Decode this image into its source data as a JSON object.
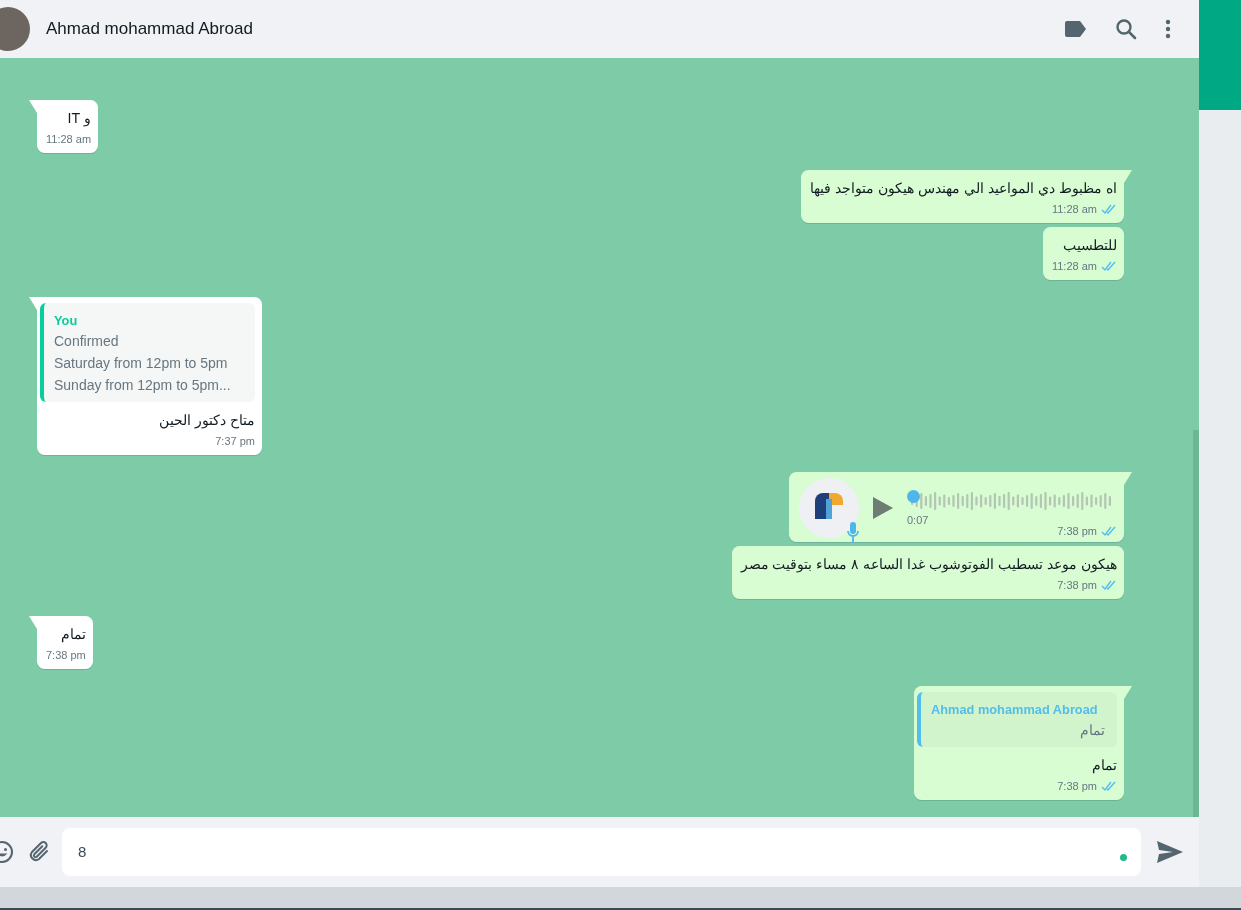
{
  "header": {
    "contact_name": "Ahmad mohammad Abroad"
  },
  "messages": [
    {
      "kind": "text",
      "outgoing": false,
      "tail": true,
      "text": "و IT",
      "time": "11:28 am"
    },
    {
      "kind": "text",
      "outgoing": true,
      "tail": true,
      "text": "اه مظبوط دي المواعيد الي مهندس هيكون متواجد فيها",
      "time": "11:28 am",
      "read": true
    },
    {
      "kind": "text",
      "outgoing": true,
      "tail": false,
      "text": "للتطسيب",
      "time": "11:28 am",
      "read": true
    },
    {
      "kind": "quote",
      "outgoing": false,
      "tail": true,
      "quote_author": "You",
      "quote_lines": [
        "Confirmed",
        "Saturday from 12pm to 5pm",
        "Sunday from 12pm to 5pm..."
      ],
      "text": "متاح دكتور الحين",
      "time": "7:37 pm"
    },
    {
      "kind": "voice",
      "outgoing": true,
      "tail": true,
      "duration": "0:07",
      "level": 0.0,
      "time": "7:38 pm",
      "read": true
    },
    {
      "kind": "text",
      "outgoing": true,
      "tail": false,
      "text": "هيكون موعد تسطيب الفوتوشوب غدا الساعه ٨ مساء بتوقيت مصر",
      "time": "7:38 pm",
      "read": true
    },
    {
      "kind": "text",
      "outgoing": false,
      "tail": true,
      "text": "تمام",
      "time": "7:38 pm"
    },
    {
      "kind": "quote",
      "outgoing": true,
      "tail": true,
      "quote_author": "Ahmad mohammad Abroad",
      "quote_lines": [
        "تمام"
      ],
      "text": "تمام",
      "time": "7:38 pm",
      "read": true
    }
  ],
  "composer": {
    "value": "8"
  }
}
